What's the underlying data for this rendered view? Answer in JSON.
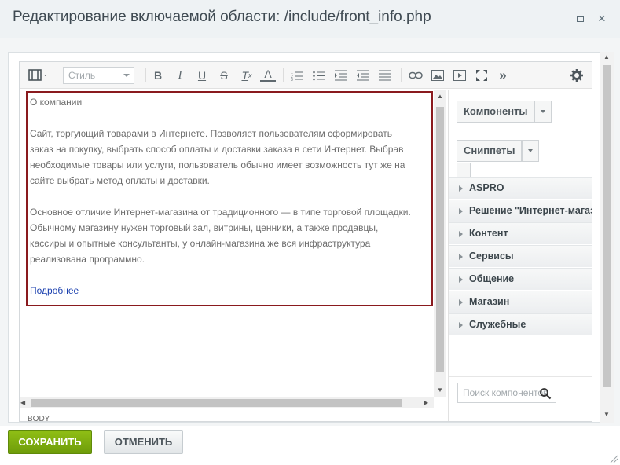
{
  "dialog": {
    "title": "Редактирование включаемой области: /include/front_info.php",
    "close_glyph": "×"
  },
  "toolbar": {
    "style_placeholder": "Стиль",
    "bold": "B",
    "italic": "I",
    "underline": "U",
    "strike": "S",
    "clear_format": "T",
    "clear_format_sub": "x",
    "font_color": "A",
    "more": "»"
  },
  "content": {
    "heading": "О компании",
    "paragraph1": [
      "Сайт, торгующий товарами в Интернете. Позволяет пользователям сформировать",
      "заказ на покупку, выбрать способ оплаты и доставки заказа в сети Интернет. Выбрав",
      "необходимые товары или услуги, пользователь обычно имеет возможность тут же на",
      "сайте выбрать метод оплаты и доставки."
    ],
    "paragraph2": [
      "Основное отличие Интернет-магазина от традиционного — в типе торговой площадки.",
      "Обычному магазину нужен торговый зал, витрины, ценники, а также продавцы,",
      "кассиры и опытные консультанты, у онлайн-магазина же вся инфраструктура",
      "реализована программно."
    ],
    "link": "Подробнее"
  },
  "statusbar": {
    "path": "BODY"
  },
  "panel": {
    "components_label": "Компоненты",
    "snippets_label": "Сниппеты",
    "groups": [
      "ASPRO",
      "Решение \"Интернет-магазин\"",
      "Контент",
      "Сервисы",
      "Общение",
      "Магазин",
      "Служебные"
    ],
    "search_placeholder": "Поиск компонентов"
  },
  "footer": {
    "save_label": "СОХРАНИТЬ",
    "cancel_label": "ОТМЕНИТЬ"
  },
  "colors": {
    "save": "#7aac0f",
    "content_border": "#8a1a1e",
    "link": "#1a3fae"
  }
}
